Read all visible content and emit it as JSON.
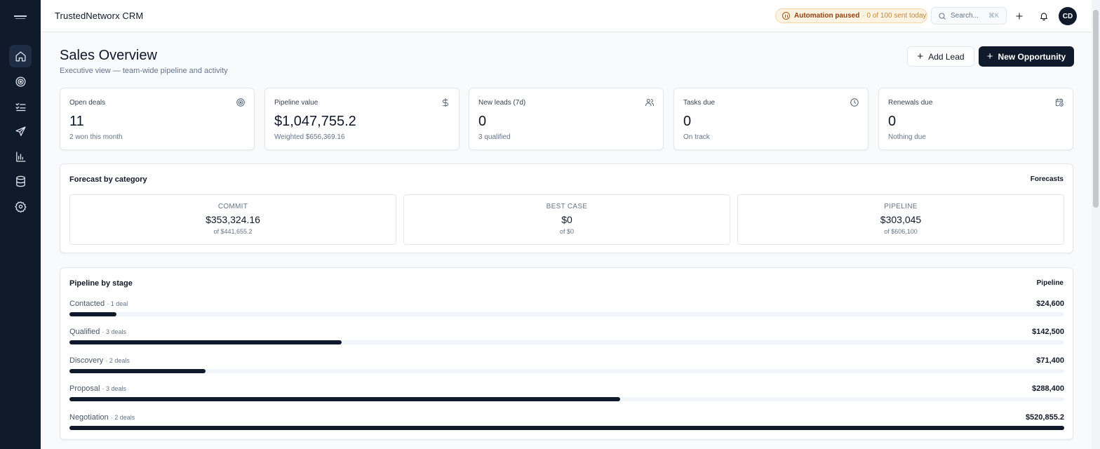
{
  "app": {
    "title": "TrustedNetworx CRM"
  },
  "sidebar": {
    "items": [
      {
        "name": "home",
        "icon": "home-icon"
      },
      {
        "name": "targets",
        "icon": "target-icon"
      },
      {
        "name": "tasks",
        "icon": "checklist-icon"
      },
      {
        "name": "outreach",
        "icon": "send-icon"
      },
      {
        "name": "reports",
        "icon": "bar-chart-icon"
      },
      {
        "name": "database",
        "icon": "database-icon"
      },
      {
        "name": "settings",
        "icon": "gear-icon"
      }
    ]
  },
  "header": {
    "automation_status": "Automation paused",
    "automation_detail": "· 0 of 100 sent today",
    "search_placeholder": "Search...",
    "search_shortcut": "⌘K",
    "avatar_initials": "CD"
  },
  "page": {
    "title": "Sales Overview",
    "subtitle": "Executive view — team-wide pipeline and activity",
    "add_lead_label": "Add Lead",
    "new_opportunity_label": "New Opportunity"
  },
  "stats": [
    {
      "label": "Open deals",
      "value": "11",
      "sub": "2 won this month",
      "icon": "target-icon"
    },
    {
      "label": "Pipeline value",
      "value": "$1,047,755.2",
      "sub": "Weighted $656,369.16",
      "icon": "dollar-icon"
    },
    {
      "label": "New leads (7d)",
      "value": "0",
      "sub": "3 qualified",
      "icon": "users-icon"
    },
    {
      "label": "Tasks due",
      "value": "0",
      "sub": "On track",
      "icon": "clock-icon"
    },
    {
      "label": "Renewals due",
      "value": "0",
      "sub": "Nothing due",
      "icon": "calendar-clock-icon"
    }
  ],
  "forecast": {
    "title": "Forecast by category",
    "link": "Forecasts",
    "categories": [
      {
        "label": "COMMIT",
        "value": "$353,324.16",
        "of": "of $441,655.2"
      },
      {
        "label": "BEST CASE",
        "value": "$0",
        "of": "of $0"
      },
      {
        "label": "PIPELINE",
        "value": "$303,045",
        "of": "of $606,100"
      }
    ]
  },
  "pipeline": {
    "title": "Pipeline by stage",
    "link": "Pipeline",
    "max_value": 520855.2,
    "stages": [
      {
        "name": "Contacted",
        "count": "· 1 deal",
        "value_label": "$24,600",
        "value": 24600
      },
      {
        "name": "Qualified",
        "count": "· 3 deals",
        "value_label": "$142,500",
        "value": 142500
      },
      {
        "name": "Discovery",
        "count": "· 2 deals",
        "value_label": "$71,400",
        "value": 71400
      },
      {
        "name": "Proposal",
        "count": "· 3 deals",
        "value_label": "$288,400",
        "value": 288400
      },
      {
        "name": "Negotiation",
        "count": "· 2 deals",
        "value_label": "$520,855.2",
        "value": 520855.2
      }
    ]
  },
  "colors": {
    "sidebar": "#0f1a2b",
    "accent": "#0f1a2b",
    "warning_bg": "#fdf3e3",
    "warning_text": "#92400e"
  }
}
